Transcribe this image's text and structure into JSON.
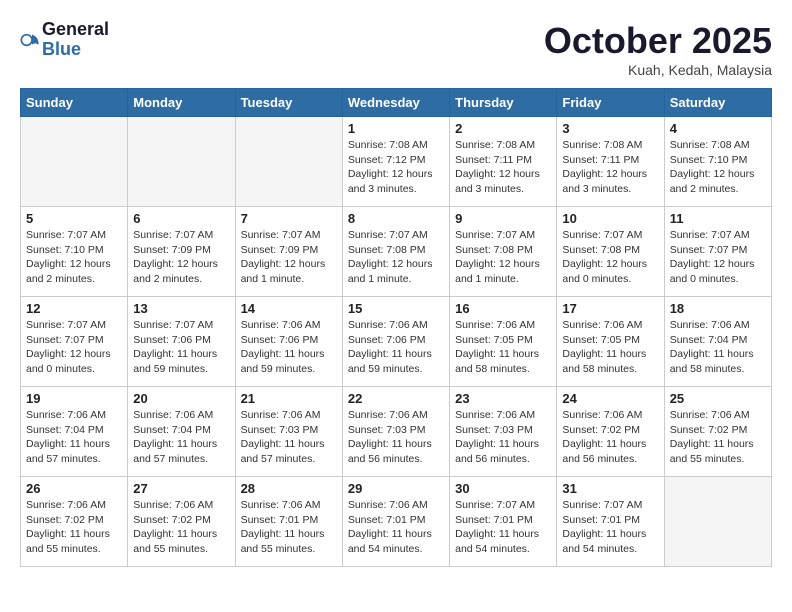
{
  "header": {
    "logo_line1": "General",
    "logo_line2": "Blue",
    "month_title": "October 2025",
    "location": "Kuah, Kedah, Malaysia"
  },
  "weekdays": [
    "Sunday",
    "Monday",
    "Tuesday",
    "Wednesday",
    "Thursday",
    "Friday",
    "Saturday"
  ],
  "weeks": [
    [
      {
        "day": "",
        "info": ""
      },
      {
        "day": "",
        "info": ""
      },
      {
        "day": "",
        "info": ""
      },
      {
        "day": "1",
        "info": "Sunrise: 7:08 AM\nSunset: 7:12 PM\nDaylight: 12 hours\nand 3 minutes."
      },
      {
        "day": "2",
        "info": "Sunrise: 7:08 AM\nSunset: 7:11 PM\nDaylight: 12 hours\nand 3 minutes."
      },
      {
        "day": "3",
        "info": "Sunrise: 7:08 AM\nSunset: 7:11 PM\nDaylight: 12 hours\nand 3 minutes."
      },
      {
        "day": "4",
        "info": "Sunrise: 7:08 AM\nSunset: 7:10 PM\nDaylight: 12 hours\nand 2 minutes."
      }
    ],
    [
      {
        "day": "5",
        "info": "Sunrise: 7:07 AM\nSunset: 7:10 PM\nDaylight: 12 hours\nand 2 minutes."
      },
      {
        "day": "6",
        "info": "Sunrise: 7:07 AM\nSunset: 7:09 PM\nDaylight: 12 hours\nand 2 minutes."
      },
      {
        "day": "7",
        "info": "Sunrise: 7:07 AM\nSunset: 7:09 PM\nDaylight: 12 hours\nand 1 minute."
      },
      {
        "day": "8",
        "info": "Sunrise: 7:07 AM\nSunset: 7:08 PM\nDaylight: 12 hours\nand 1 minute."
      },
      {
        "day": "9",
        "info": "Sunrise: 7:07 AM\nSunset: 7:08 PM\nDaylight: 12 hours\nand 1 minute."
      },
      {
        "day": "10",
        "info": "Sunrise: 7:07 AM\nSunset: 7:08 PM\nDaylight: 12 hours\nand 0 minutes."
      },
      {
        "day": "11",
        "info": "Sunrise: 7:07 AM\nSunset: 7:07 PM\nDaylight: 12 hours\nand 0 minutes."
      }
    ],
    [
      {
        "day": "12",
        "info": "Sunrise: 7:07 AM\nSunset: 7:07 PM\nDaylight: 12 hours\nand 0 minutes."
      },
      {
        "day": "13",
        "info": "Sunrise: 7:07 AM\nSunset: 7:06 PM\nDaylight: 11 hours\nand 59 minutes."
      },
      {
        "day": "14",
        "info": "Sunrise: 7:06 AM\nSunset: 7:06 PM\nDaylight: 11 hours\nand 59 minutes."
      },
      {
        "day": "15",
        "info": "Sunrise: 7:06 AM\nSunset: 7:06 PM\nDaylight: 11 hours\nand 59 minutes."
      },
      {
        "day": "16",
        "info": "Sunrise: 7:06 AM\nSunset: 7:05 PM\nDaylight: 11 hours\nand 58 minutes."
      },
      {
        "day": "17",
        "info": "Sunrise: 7:06 AM\nSunset: 7:05 PM\nDaylight: 11 hours\nand 58 minutes."
      },
      {
        "day": "18",
        "info": "Sunrise: 7:06 AM\nSunset: 7:04 PM\nDaylight: 11 hours\nand 58 minutes."
      }
    ],
    [
      {
        "day": "19",
        "info": "Sunrise: 7:06 AM\nSunset: 7:04 PM\nDaylight: 11 hours\nand 57 minutes."
      },
      {
        "day": "20",
        "info": "Sunrise: 7:06 AM\nSunset: 7:04 PM\nDaylight: 11 hours\nand 57 minutes."
      },
      {
        "day": "21",
        "info": "Sunrise: 7:06 AM\nSunset: 7:03 PM\nDaylight: 11 hours\nand 57 minutes."
      },
      {
        "day": "22",
        "info": "Sunrise: 7:06 AM\nSunset: 7:03 PM\nDaylight: 11 hours\nand 56 minutes."
      },
      {
        "day": "23",
        "info": "Sunrise: 7:06 AM\nSunset: 7:03 PM\nDaylight: 11 hours\nand 56 minutes."
      },
      {
        "day": "24",
        "info": "Sunrise: 7:06 AM\nSunset: 7:02 PM\nDaylight: 11 hours\nand 56 minutes."
      },
      {
        "day": "25",
        "info": "Sunrise: 7:06 AM\nSunset: 7:02 PM\nDaylight: 11 hours\nand 55 minutes."
      }
    ],
    [
      {
        "day": "26",
        "info": "Sunrise: 7:06 AM\nSunset: 7:02 PM\nDaylight: 11 hours\nand 55 minutes."
      },
      {
        "day": "27",
        "info": "Sunrise: 7:06 AM\nSunset: 7:02 PM\nDaylight: 11 hours\nand 55 minutes."
      },
      {
        "day": "28",
        "info": "Sunrise: 7:06 AM\nSunset: 7:01 PM\nDaylight: 11 hours\nand 55 minutes."
      },
      {
        "day": "29",
        "info": "Sunrise: 7:06 AM\nSunset: 7:01 PM\nDaylight: 11 hours\nand 54 minutes."
      },
      {
        "day": "30",
        "info": "Sunrise: 7:07 AM\nSunset: 7:01 PM\nDaylight: 11 hours\nand 54 minutes."
      },
      {
        "day": "31",
        "info": "Sunrise: 7:07 AM\nSunset: 7:01 PM\nDaylight: 11 hours\nand 54 minutes."
      },
      {
        "day": "",
        "info": ""
      }
    ]
  ]
}
